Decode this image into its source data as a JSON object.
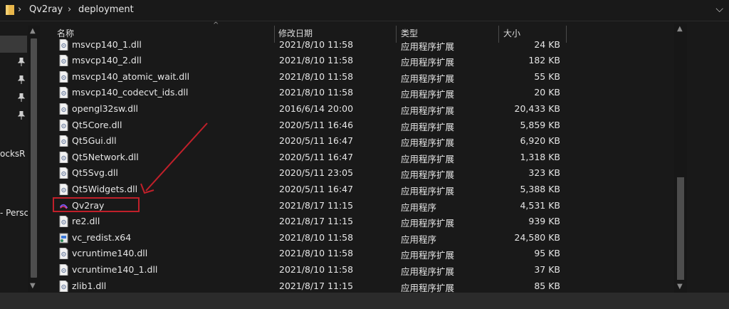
{
  "address": {
    "crumbs": [
      "Qv2ray",
      "deployment"
    ]
  },
  "nav": {
    "items": [
      "ocksR",
      "- Persc"
    ]
  },
  "columns": {
    "name": "名称",
    "date": "修改日期",
    "type": "类型",
    "size": "大小"
  },
  "files": [
    {
      "name": "msvcp140_1.dll",
      "date": "2021/8/10 11:58",
      "type": "应用程序扩展",
      "size": "24 KB",
      "icon": "dll-file-icon"
    },
    {
      "name": "msvcp140_2.dll",
      "date": "2021/8/10 11:58",
      "type": "应用程序扩展",
      "size": "182 KB",
      "icon": "dll-file-icon"
    },
    {
      "name": "msvcp140_atomic_wait.dll",
      "date": "2021/8/10 11:58",
      "type": "应用程序扩展",
      "size": "55 KB",
      "icon": "dll-file-icon"
    },
    {
      "name": "msvcp140_codecvt_ids.dll",
      "date": "2021/8/10 11:58",
      "type": "应用程序扩展",
      "size": "20 KB",
      "icon": "dll-file-icon"
    },
    {
      "name": "opengl32sw.dll",
      "date": "2016/6/14 20:00",
      "type": "应用程序扩展",
      "size": "20,433 KB",
      "icon": "dll-file-icon"
    },
    {
      "name": "Qt5Core.dll",
      "date": "2020/5/11 16:46",
      "type": "应用程序扩展",
      "size": "5,859 KB",
      "icon": "dll-file-icon"
    },
    {
      "name": "Qt5Gui.dll",
      "date": "2020/5/11 16:47",
      "type": "应用程序扩展",
      "size": "6,920 KB",
      "icon": "dll-file-icon"
    },
    {
      "name": "Qt5Network.dll",
      "date": "2020/5/11 16:47",
      "type": "应用程序扩展",
      "size": "1,318 KB",
      "icon": "dll-file-icon"
    },
    {
      "name": "Qt5Svg.dll",
      "date": "2020/5/11 23:05",
      "type": "应用程序扩展",
      "size": "323 KB",
      "icon": "dll-file-icon"
    },
    {
      "name": "Qt5Widgets.dll",
      "date": "2020/5/11 16:47",
      "type": "应用程序扩展",
      "size": "5,388 KB",
      "icon": "dll-file-icon"
    },
    {
      "name": "Qv2ray",
      "date": "2021/8/17 11:15",
      "type": "应用程序",
      "size": "4,531 KB",
      "icon": "qv2ray-app-icon"
    },
    {
      "name": "re2.dll",
      "date": "2021/8/17 11:15",
      "type": "应用程序扩展",
      "size": "939 KB",
      "icon": "dll-file-icon"
    },
    {
      "name": "vc_redist.x64",
      "date": "2021/8/10 11:58",
      "type": "应用程序",
      "size": "24,580 KB",
      "icon": "installer-icon"
    },
    {
      "name": "vcruntime140.dll",
      "date": "2021/8/10 11:58",
      "type": "应用程序扩展",
      "size": "95 KB",
      "icon": "dll-file-icon"
    },
    {
      "name": "vcruntime140_1.dll",
      "date": "2021/8/10 11:58",
      "type": "应用程序扩展",
      "size": "37 KB",
      "icon": "dll-file-icon"
    },
    {
      "name": "zlib1.dll",
      "date": "2021/8/17 11:15",
      "type": "应用程序扩展",
      "size": "85 KB",
      "icon": "dll-file-icon"
    }
  ],
  "colors": {
    "background": "#191919",
    "annotation": "#c0202a"
  }
}
